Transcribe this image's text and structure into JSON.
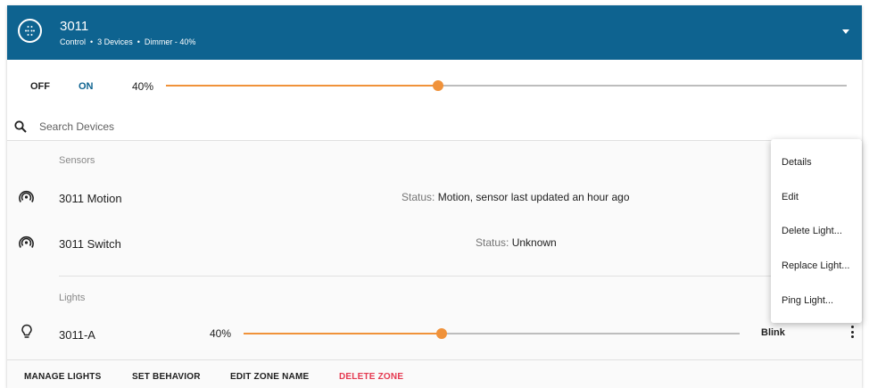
{
  "header": {
    "title": "3011",
    "subtitle_parts": [
      "Control",
      "3 Devices",
      "Dimmer - 40%"
    ],
    "separator": "•",
    "zone_icon": "grid-dots-icon",
    "expand_icon": "chevron-down-icon"
  },
  "control": {
    "off_label": "OFF",
    "on_label": "ON",
    "level_label": "40%",
    "level_fraction": 0.4,
    "accent_color": "#f0923a",
    "active_color": "#0e6390"
  },
  "search": {
    "placeholder": "Search Devices",
    "value": ""
  },
  "sensors": {
    "section_label": "Sensors",
    "items": [
      {
        "name": "3011 Motion",
        "status_key": "Status:",
        "status_value": "Motion, sensor last updated an hour ago",
        "icon": "sensor-signal-icon"
      },
      {
        "name": "3011 Switch",
        "status_key": "Status:",
        "status_value": "Unknown",
        "icon": "sensor-signal-icon"
      }
    ]
  },
  "lights": {
    "section_label": "Lights",
    "items": [
      {
        "name": "3011-A",
        "level_label": "40%",
        "level_fraction": 0.4,
        "blink_label": "Blink",
        "icon": "lightbulb-icon"
      }
    ]
  },
  "footer": {
    "manage_lights": "MANAGE LIGHTS",
    "set_behavior": "SET BEHAVIOR",
    "edit_zone_name": "EDIT ZONE NAME",
    "delete_zone": "DELETE ZONE",
    "danger_color": "#e53950"
  },
  "context_menu": {
    "items": [
      "Details",
      "Edit",
      "Delete Light...",
      "Replace Light...",
      "Ping Light..."
    ]
  }
}
